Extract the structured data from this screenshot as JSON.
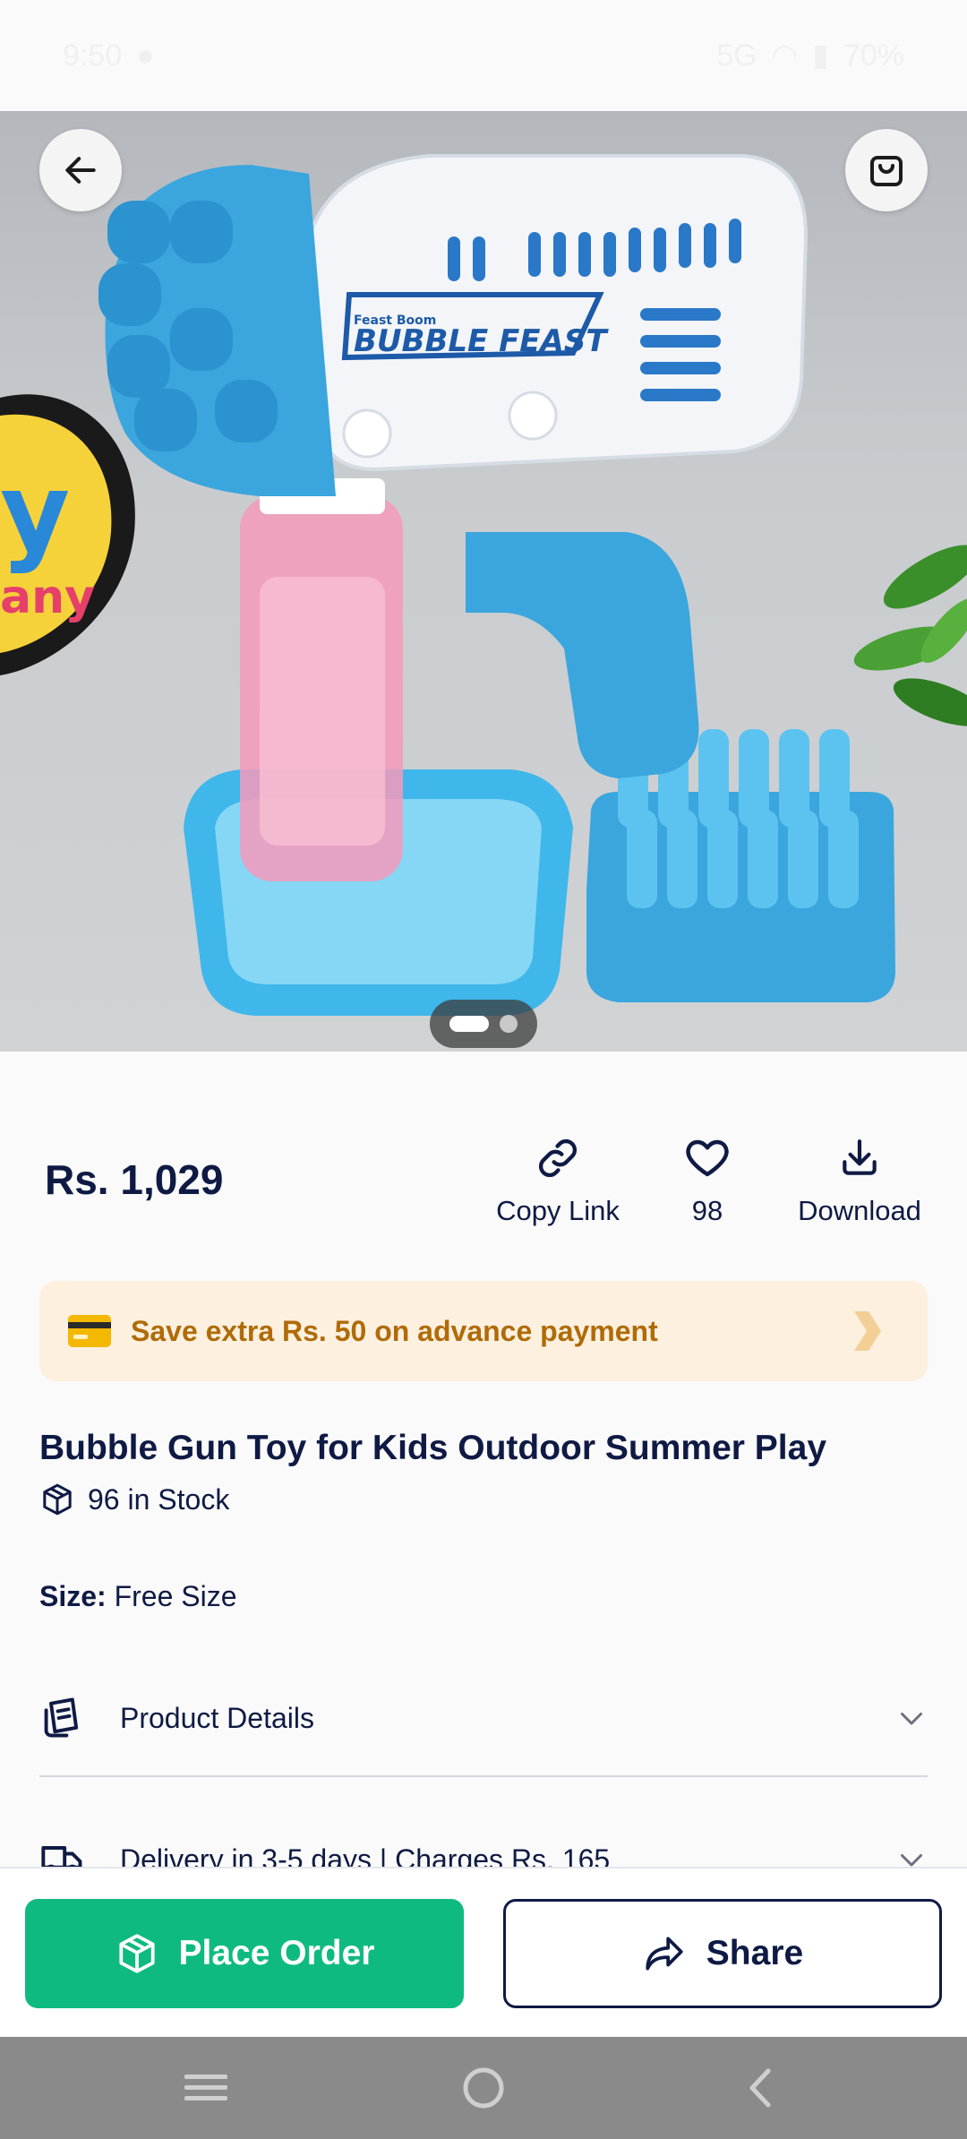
{
  "status_bar": {
    "time": "9:50",
    "network": "5G",
    "battery": "70%"
  },
  "hero": {
    "image_alt": "Bubble Gun Toy",
    "carousel_total": 2,
    "carousel_active": 1,
    "icons": {
      "back": "arrow-left-icon",
      "cart": "shopping-bag-icon"
    },
    "printed": {
      "brand_small": "Feast Boom",
      "brand": "BUBBLE FEAST"
    }
  },
  "product": {
    "price": "Rs. 1,029",
    "title": "Bubble Gun Toy for Kids Outdoor Summer Play",
    "stock": "96 in Stock",
    "size_label": "Size:",
    "size_value": "Free Size"
  },
  "actions": {
    "copy_link": "Copy Link",
    "likes": "98",
    "download": "Download"
  },
  "banner": {
    "text": "Save extra Rs. 50 on advance payment"
  },
  "sections": {
    "details": "Product Details",
    "delivery": "Delivery in 3-5 days | Charges Rs. 165"
  },
  "bottom_bar": {
    "place_order": "Place Order",
    "share": "Share"
  },
  "colors": {
    "primary_navy": "#0f1a44",
    "accent_green": "#0fba81",
    "banner_bg": "#fdf0df",
    "banner_text": "#b06b08"
  }
}
